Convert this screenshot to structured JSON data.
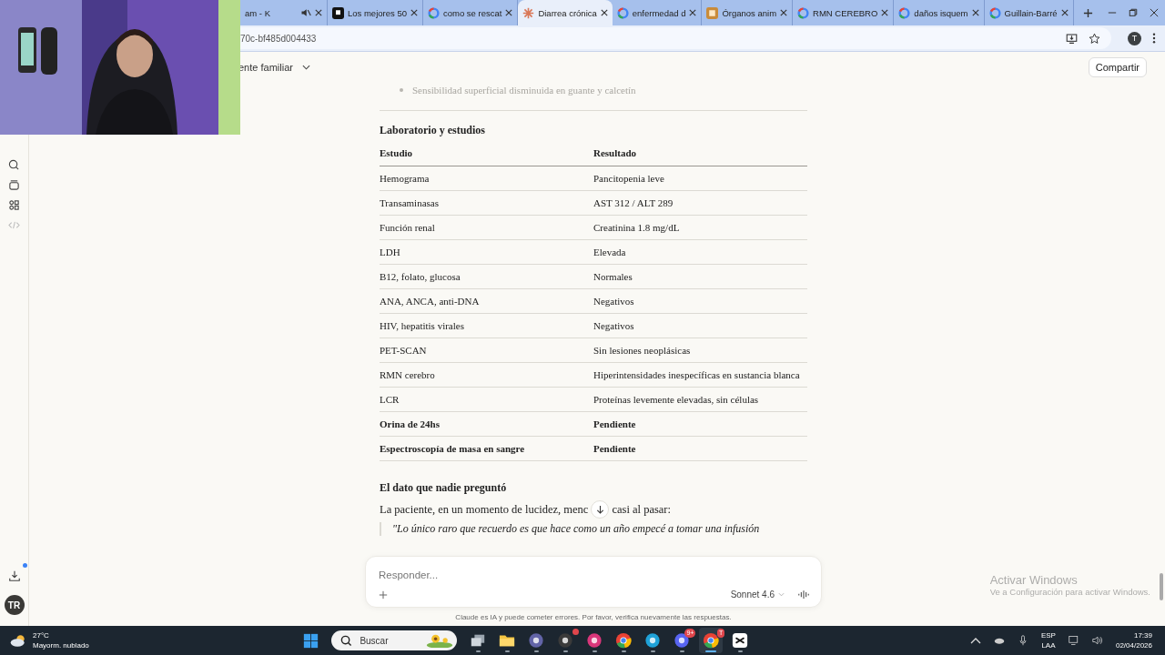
{
  "tabs": [
    {
      "title": "am - K",
      "kind": "plain",
      "muted": true,
      "selected": false
    },
    {
      "title": "Los mejores 50",
      "kind": "square",
      "muted": false,
      "selected": false
    },
    {
      "title": "como se rescat",
      "kind": "google",
      "muted": false,
      "selected": false
    },
    {
      "title": "Diarrea crónica",
      "kind": "star",
      "muted": false,
      "selected": true
    },
    {
      "title": "enfermedad d",
      "kind": "google",
      "muted": false,
      "selected": false
    },
    {
      "title": "Órganos anim",
      "kind": "tile",
      "muted": false,
      "selected": false
    },
    {
      "title": "RMN CEREBRO",
      "kind": "google",
      "muted": false,
      "selected": false
    },
    {
      "title": "daños isquem",
      "kind": "google",
      "muted": false,
      "selected": false
    },
    {
      "title": "Guillain-Barré",
      "kind": "google",
      "muted": false,
      "selected": false
    }
  ],
  "address_bar": {
    "url": "70c-bf485d004433",
    "profile": "T"
  },
  "header": {
    "title": "ente familiar",
    "share_button": "Compartir"
  },
  "sidebar": {
    "avatar": "TR",
    "download_badge": true
  },
  "content": {
    "faded_bullet": "Sensibilidad superficial disminuida en guante y calcetín",
    "section_title": "Laboratorio y estudios",
    "table": {
      "columns": [
        "Estudio",
        "Resultado"
      ],
      "rows": [
        {
          "cells": [
            "Hemograma",
            "Pancitopenia leve"
          ],
          "emphasis": false
        },
        {
          "cells": [
            "Transaminasas",
            "AST 312 / ALT 289"
          ],
          "emphasis": false
        },
        {
          "cells": [
            "Función renal",
            "Creatinina 1.8 mg/dL"
          ],
          "emphasis": false
        },
        {
          "cells": [
            "LDH",
            "Elevada"
          ],
          "emphasis": false
        },
        {
          "cells": [
            "B12, folato, glucosa",
            "Normales"
          ],
          "emphasis": false
        },
        {
          "cells": [
            "ANA, ANCA, anti-DNA",
            "Negativos"
          ],
          "emphasis": false
        },
        {
          "cells": [
            "HIV, hepatitis virales",
            "Negativos"
          ],
          "emphasis": false
        },
        {
          "cells": [
            "PET-SCAN",
            "Sin lesiones neoplásicas"
          ],
          "emphasis": false
        },
        {
          "cells": [
            "RMN cerebro",
            "Hiperintensidades inespecíficas en sustancia blanca"
          ],
          "emphasis": false
        },
        {
          "cells": [
            "LCR",
            "Proteínas levemente elevadas, sin células"
          ],
          "emphasis": false
        },
        {
          "cells": [
            "Orina de 24hs",
            "Pendiente"
          ],
          "emphasis": true
        },
        {
          "cells": [
            "Espectroscopía de masa en sangre",
            "Pendiente"
          ],
          "emphasis": true
        }
      ]
    },
    "subtitle": "El dato que nadie preguntó",
    "paragraph_before": "La paciente, en un momento de lucidez, menc",
    "paragraph_after": "casi al pasar:",
    "quote": "\"Lo único raro que recuerdo es que hace como un año empecé a tomar una infusión"
  },
  "composer": {
    "placeholder": "Responder...",
    "model": "Sonnet 4.6"
  },
  "disclaimer": "Claude es IA y puede cometer errores. Por favor, verifica nuevamente las respuestas.",
  "activation": {
    "title": "Activar Windows",
    "subtitle": "Ve a Configuración para activar Windows."
  },
  "taskbar": {
    "temperature": "27°C",
    "weather": "Mayorm. nublado",
    "search": "Buscar",
    "apps": [
      {
        "kind": "taskview",
        "notification": false,
        "active": false
      },
      {
        "kind": "folder",
        "notification": false,
        "active": false
      },
      {
        "kind": "teams",
        "notification": false,
        "active": false
      },
      {
        "kind": "obs",
        "notification": true,
        "active": false
      },
      {
        "kind": "affinity",
        "notification": false,
        "active": false
      },
      {
        "kind": "chrome",
        "notification": false,
        "active": false
      },
      {
        "kind": "edge",
        "notification": false,
        "active": false
      },
      {
        "kind": "discord",
        "notification": false,
        "badge": "9+",
        "active": false
      },
      {
        "kind": "chrome",
        "notification": false,
        "badge": "T",
        "active": true
      },
      {
        "kind": "capcut",
        "notification": false,
        "active": false
      }
    ],
    "language": "ESP",
    "layout": "LAA",
    "time": "17:39",
    "date": "02/04/2026"
  }
}
